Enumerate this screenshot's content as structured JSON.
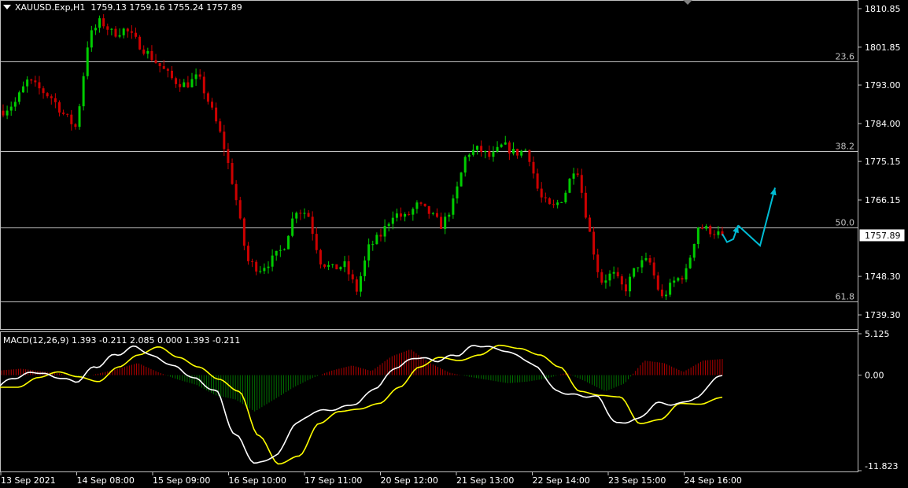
{
  "header": {
    "symbol": "XAUUSD.Exp,H1",
    "ohlc": "1759.13 1759.16 1755.24 1757.89"
  },
  "macd_header": "MACD(12,26,9) 1.393 -0.211 2.085 0.000 1.393 -0.211",
  "price_axis_labels": [
    "1810.85",
    "1801.85",
    "1793.00",
    "1784.00",
    "1775.15",
    "1766.15",
    "1757.89",
    "1748.30",
    "1739.30"
  ],
  "macd_axis_labels": [
    "5.125",
    "0.00",
    "-11.823"
  ],
  "time_labels": [
    "13 Sep 2021",
    "14 Sep 08:00",
    "15 Sep 09:00",
    "16 Sep 10:00",
    "17 Sep 11:00",
    "20 Sep 12:00",
    "21 Sep 13:00",
    "22 Sep 14:00",
    "23 Sep 15:00",
    "24 Sep 16:00"
  ],
  "fib_levels": [
    {
      "label": "23.6",
      "price": 1798.5
    },
    {
      "label": "38.2",
      "price": 1777.5
    },
    {
      "label": "50.0",
      "price": 1759.7
    },
    {
      "label": "61.8",
      "price": 1742.4
    }
  ],
  "colors": {
    "bull": "#00cc00",
    "bear": "#cc0000",
    "macd_line": "#ffffff",
    "signal_line": "#ffff00",
    "arrow": "#00bcd4",
    "fib": "#c0c0c0"
  },
  "chart_data": {
    "type": "candlestick",
    "timeframe": "H1",
    "current_price": 1757.89,
    "ylim": [
      1736.0,
      1812.5
    ],
    "macd_ylim": [
      -11.823,
      5.125
    ],
    "price_path": [
      1787,
      1789,
      1794,
      1792,
      1790,
      1786,
      1783,
      1804,
      1808,
      1805,
      1806,
      1803,
      1800,
      1797,
      1794,
      1793,
      1795,
      1788,
      1780,
      1768,
      1752,
      1750,
      1752,
      1755,
      1764,
      1763,
      1752,
      1750,
      1751,
      1745,
      1755,
      1758,
      1763,
      1762,
      1765,
      1763,
      1760,
      1766,
      1777,
      1778,
      1776,
      1779,
      1777,
      1778,
      1767,
      1764,
      1767,
      1775,
      1760,
      1747,
      1749,
      1745,
      1751,
      1752,
      1743,
      1747,
      1749,
      1760,
      1759,
      1757.89
    ],
    "macd_signal_path": [
      -1.5,
      -0.3,
      0.4,
      -0.2,
      -0.8,
      1.0,
      2.5,
      3.5,
      2.2,
      1.0,
      -0.5,
      -2.0,
      -7.5,
      -11.0,
      -10.0,
      -6.0,
      -4.5,
      -4.2,
      -3.5,
      -1.5,
      1.0,
      2.2,
      1.8,
      2.5,
      3.7,
      3.3,
      2.5,
      1.0,
      -2.0,
      -2.5,
      -2.7,
      -6.0,
      -5.5,
      -3.5,
      -3.6,
      -2.8,
      -0.2
    ],
    "macd_histogram_path": [
      0.6,
      0.8,
      0.5,
      0.2,
      -0.3,
      0.2,
      0.8,
      1.5,
      0.4,
      -0.5,
      -1.2,
      -2.5,
      -3.0,
      -4.5,
      -3.0,
      -1.5,
      -0.3,
      0.6,
      1.2,
      0.5,
      2.3,
      3.2,
      1.5,
      0.3,
      -0.2,
      -0.6,
      -1.0,
      -0.8,
      -0.4,
      0.3,
      -0.8,
      -2.0,
      -1.0,
      1.8,
      1.5,
      0.4,
      1.8,
      2.0
    ],
    "projection_arrows": [
      {
        "from": [
          1758.2,
          1756.5
        ],
        "to": "1759.7",
        "type": "zigzag-short"
      },
      {
        "from": "1759.7",
        "to": "1769.0",
        "type": "zigzag-long"
      }
    ]
  }
}
